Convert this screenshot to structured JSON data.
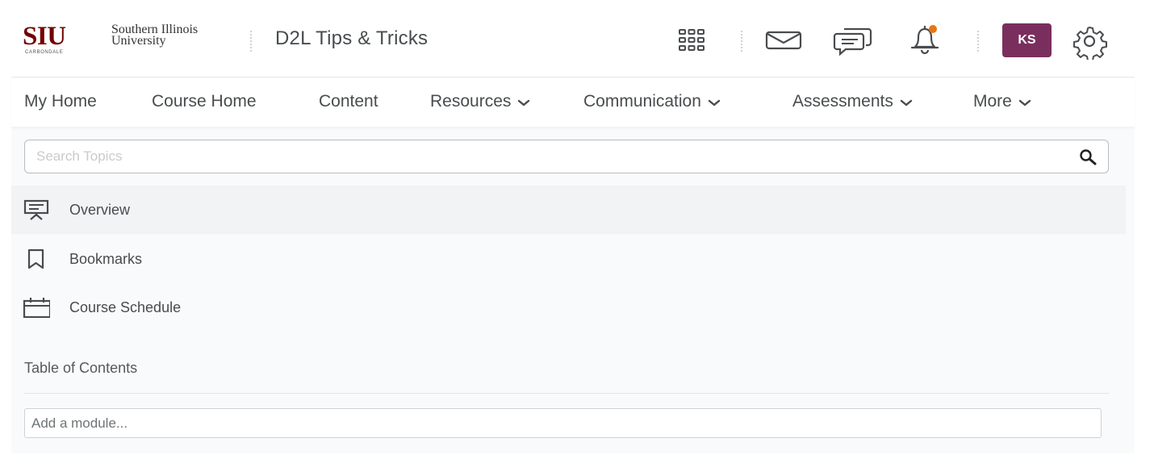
{
  "header": {
    "logo": {
      "mark": "SIU",
      "subtitle": "CARBONDALE",
      "university_line1": "Southern Illinois",
      "university_line2": "University"
    },
    "course_title": "D2L Tips & Tricks",
    "icons": [
      "waffle-grid-icon",
      "mail-icon",
      "chat-icon",
      "bell-icon",
      "gear-icon"
    ],
    "notification_dot_color": "#e87511",
    "avatar": {
      "initials": "KS",
      "color": "#7a2e5e"
    }
  },
  "nav": {
    "items": [
      {
        "label": "My Home",
        "has_dropdown": false
      },
      {
        "label": "Course Home",
        "has_dropdown": false
      },
      {
        "label": "Content",
        "has_dropdown": false
      },
      {
        "label": "Resources",
        "has_dropdown": true
      },
      {
        "label": "Communication",
        "has_dropdown": true
      },
      {
        "label": "Assessments",
        "has_dropdown": true
      },
      {
        "label": "More",
        "has_dropdown": true
      }
    ]
  },
  "search": {
    "placeholder": "Search Topics",
    "value": ""
  },
  "sidebar": {
    "items": [
      {
        "label": "Overview",
        "icon": "presentation-icon",
        "active": true
      },
      {
        "label": "Bookmarks",
        "icon": "bookmark-icon",
        "active": false
      },
      {
        "label": "Course Schedule",
        "icon": "calendar-icon",
        "active": false
      }
    ],
    "toc_heading": "Table of Contents",
    "add_module_placeholder": "Add a module..."
  }
}
